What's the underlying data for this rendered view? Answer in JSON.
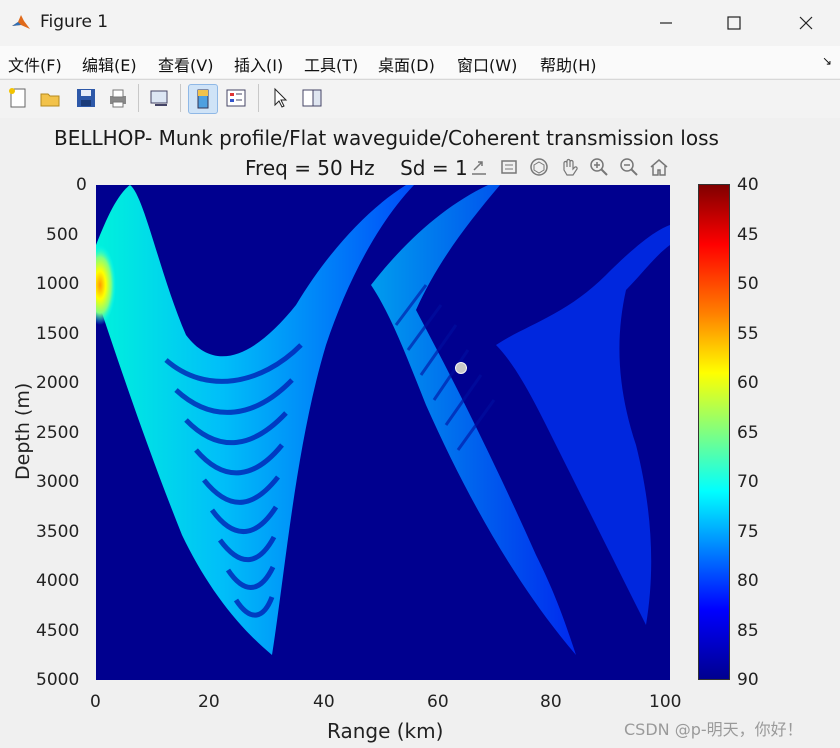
{
  "window": {
    "title": "Figure 1"
  },
  "menu": [
    "文件(F)",
    "编辑(E)",
    "查看(V)",
    "插入(I)",
    "工具(T)",
    "桌面(D)",
    "窗口(W)",
    "帮助(H)"
  ],
  "plot": {
    "title_line1": "BELLHOP- Munk profile/Flat waveguide/Coherent transmission loss",
    "title_line2": "Freq = 50 Hz    Sd = 1",
    "xlabel": "Range (km)",
    "ylabel": "Depth (m)",
    "xticks": [
      "0",
      "20",
      "40",
      "60",
      "80",
      "100"
    ],
    "yticks": [
      "0",
      "500",
      "1000",
      "1500",
      "2000",
      "2500",
      "3000",
      "3500",
      "4000",
      "4500",
      "5000"
    ],
    "colorbar_ticks": [
      "40",
      "45",
      "50",
      "55",
      "60",
      "65",
      "70",
      "75",
      "80",
      "85",
      "90"
    ]
  },
  "watermark": "CSDN @p-明天，你好！",
  "colors": {
    "background_loss": "#00008f",
    "beam": "#0040ff",
    "peak": "#ffb000"
  }
}
